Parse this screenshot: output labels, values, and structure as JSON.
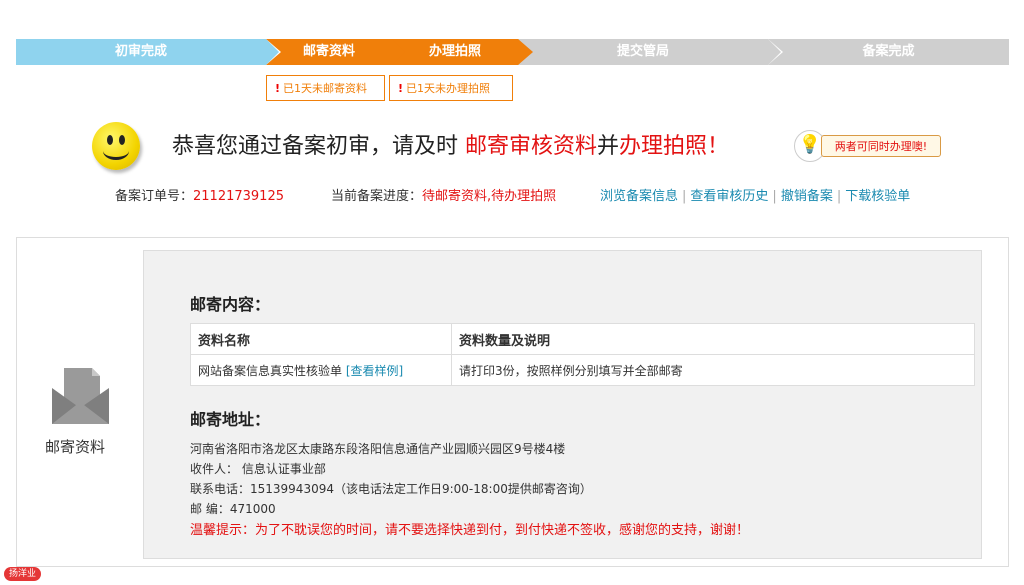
{
  "steps": [
    {
      "label": "初审完成"
    },
    {
      "label": "邮寄资料"
    },
    {
      "label": "办理拍照"
    },
    {
      "label": "提交管局"
    },
    {
      "label": "备案完成"
    }
  ],
  "notes": {
    "mail": "已1天未邮寄资料",
    "photo": "已1天未办理拍照"
  },
  "headline": {
    "part1": "恭喜您通过备案初审，请及时 ",
    "red1": "邮寄审核资料",
    "mid": "并",
    "red2": "办理拍照！"
  },
  "tip": {
    "text": "两者可同时办理噢!"
  },
  "order": {
    "label": "备案订单号：",
    "number": "21121739125"
  },
  "progress": {
    "label": "当前备案进度：",
    "value": "待邮寄资料,待办理拍照"
  },
  "links": [
    "浏览备案信息",
    "查看审核历史",
    "撤销备案",
    "下载核验单"
  ],
  "sidebar": {
    "label": "邮寄资料"
  },
  "content": {
    "title": "邮寄内容：",
    "table": {
      "headers": [
        "资料名称",
        "资料数量及说明"
      ],
      "rows": [
        {
          "name": "网站备案信息真实性核验单",
          "link": "[查看样例]",
          "desc": "请打印3份，按照样例分别填写并全部邮寄"
        }
      ]
    }
  },
  "address": {
    "title": "邮寄地址：",
    "line": "河南省洛阳市洛龙区太康路东段洛阳信息通信产业园顺兴园区9号楼4楼",
    "recipient": "收件人： 信息认证事业部",
    "phone": "联系电话：15139943094（该电话法定工作日9:00-18:00提供邮寄咨询）",
    "zip": "邮 编：471000",
    "warning": "温馨提示：为了不耽误您的时间，请不要选择快递到付，到付快递不签收，感谢您的支持，谢谢！"
  },
  "badge": "扬洋业"
}
